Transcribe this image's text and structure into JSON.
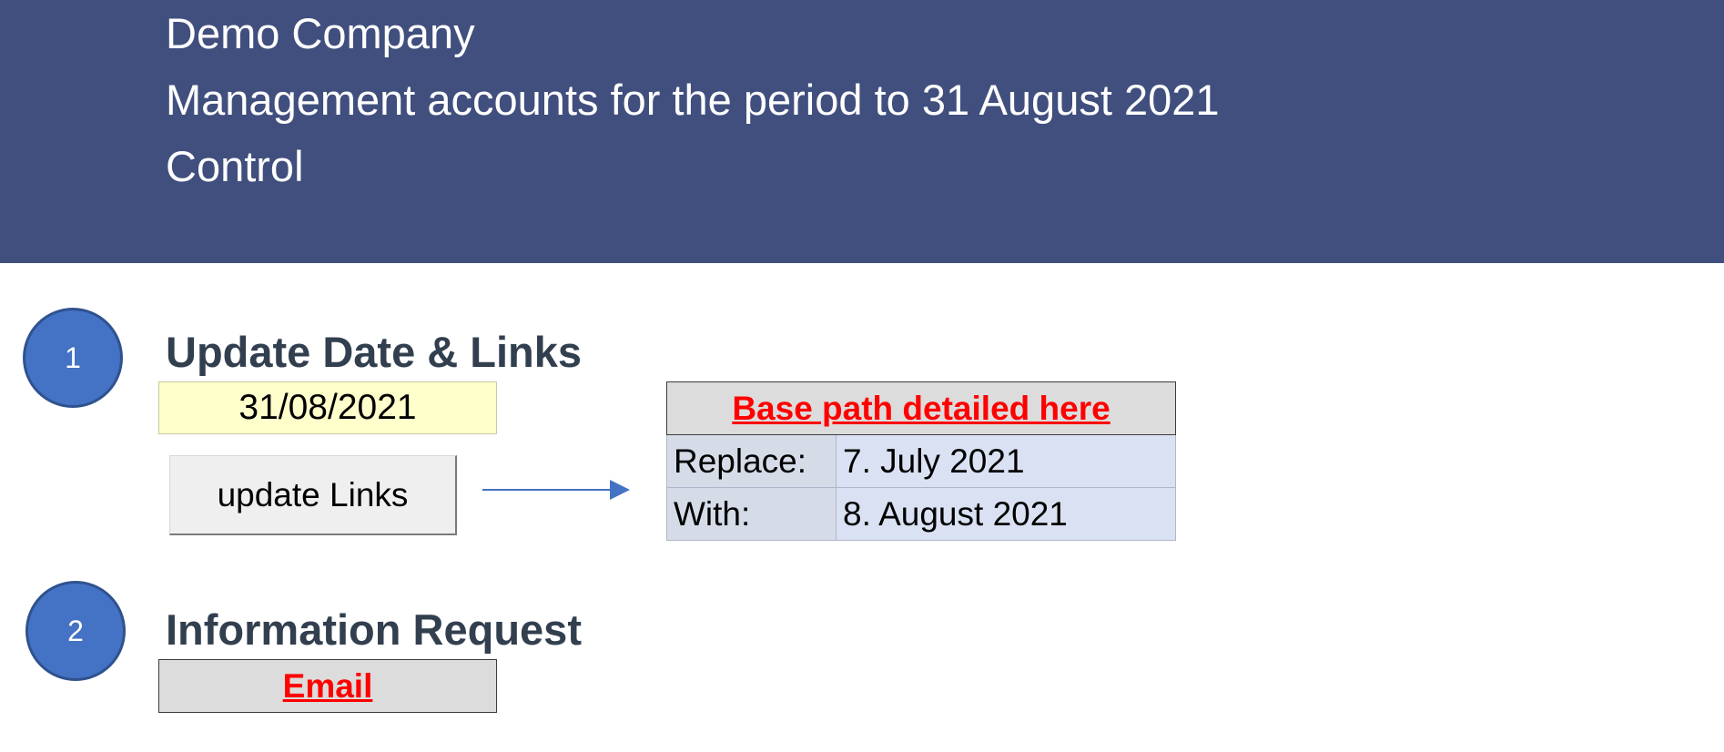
{
  "header": {
    "company": "Demo Company",
    "subtitle": "Management accounts for the period to 31 August 2021",
    "sheet_name": "Control"
  },
  "section1": {
    "number": "1",
    "title": "Update Date & Links",
    "date_value": "31/08/2021",
    "update_button_label": "update Links",
    "base_path_link": "Base path detailed here",
    "replace_label": "Replace:",
    "replace_value": "7. July 2021",
    "with_label": "With:",
    "with_value": "8. August 2021"
  },
  "section2": {
    "number": "2",
    "title": "Information Request",
    "email_link": "Email"
  },
  "colors": {
    "banner": "#414f7e",
    "circle": "#4472c4",
    "title_text": "#323f4f",
    "link_text": "#ff0000",
    "date_fill": "#ffffcc",
    "arrow": "#4472c4"
  },
  "icons": {
    "arrow": "arrow-right-icon"
  }
}
